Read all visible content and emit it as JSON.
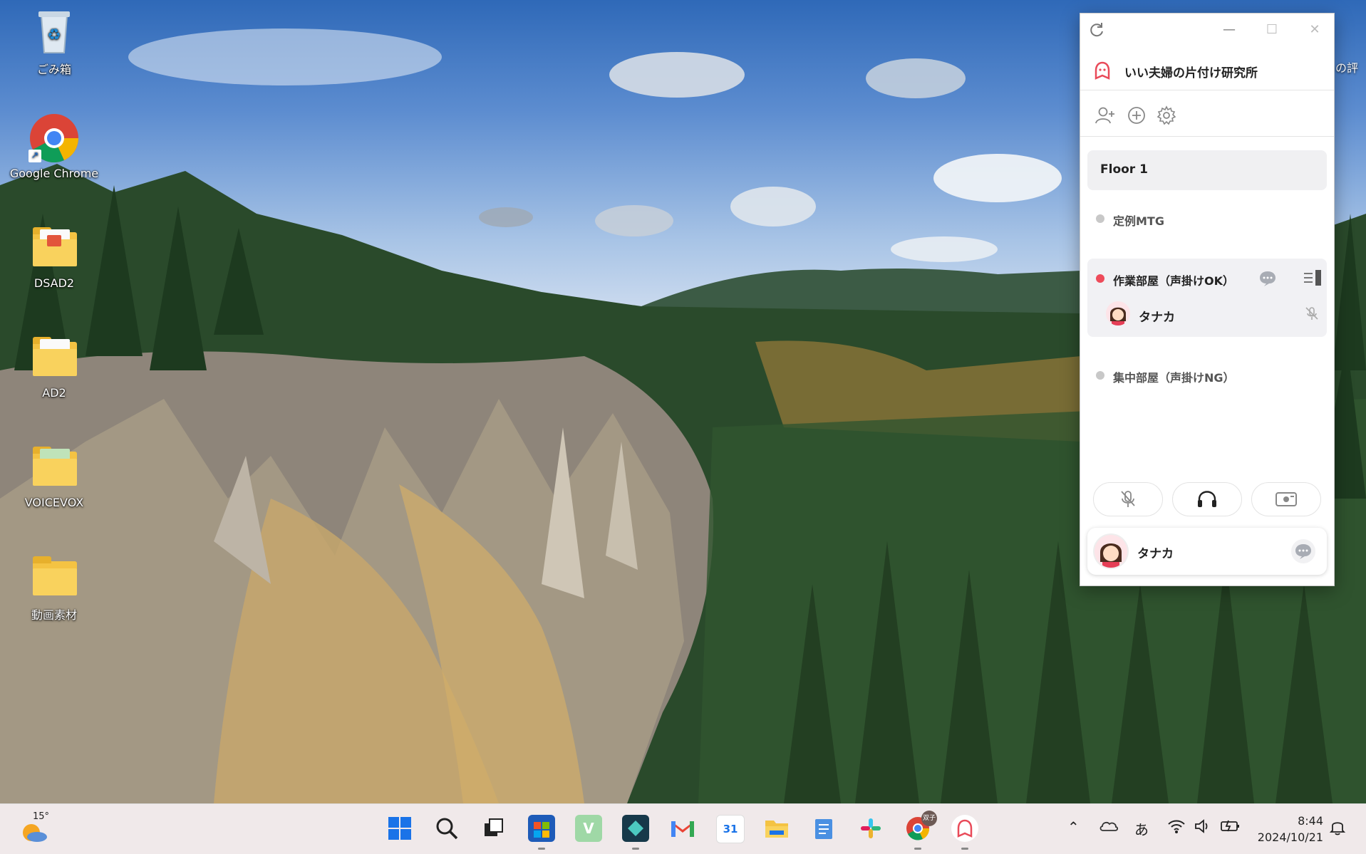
{
  "desktop": {
    "icons": [
      {
        "label": "ごみ箱",
        "icon": "recycle-bin-icon"
      },
      {
        "label": "Google Chrome",
        "icon": "chrome-icon"
      },
      {
        "label": "DSAD2",
        "icon": "folder-icon"
      },
      {
        "label": "AD2",
        "icon": "folder-icon"
      },
      {
        "label": "VOICEVOX",
        "icon": "folder-icon"
      },
      {
        "label": "動画素材",
        "icon": "folder-icon"
      }
    ],
    "edge_text": "の評"
  },
  "app": {
    "titlebar": {
      "refresh": "↻",
      "minimize": "—",
      "maximize": "☐",
      "close": "✕"
    },
    "workspace_name": "いい夫婦の片付け研究所",
    "tools": [
      "add-user-icon",
      "add-circle-icon",
      "gear-icon"
    ],
    "floor": "Floor 1",
    "rooms": [
      {
        "name": "定例MTG",
        "status_color": "#c8c8c8",
        "members": []
      },
      {
        "name": "作業部屋（声掛けOK）",
        "status_color": "#ee4b5a",
        "members": [
          {
            "name": "タナカ",
            "muted": true
          }
        ]
      },
      {
        "name": "集中部屋（声掛けNG）",
        "status_color": "#c8c8c8",
        "members": []
      }
    ],
    "controls": [
      "mic-muted-icon",
      "headphones-icon",
      "screen-share-icon"
    ],
    "self": {
      "name": "タナカ"
    }
  },
  "taskbar": {
    "weather": "15°",
    "ime": "あ",
    "time": "8:44",
    "date": "2024/10/21",
    "chrome_badge": "双子"
  },
  "colors": {
    "accent_red": "#ee4b5a",
    "window_bg": "#ffffff",
    "taskbar_bg": "#f0e9ea"
  }
}
